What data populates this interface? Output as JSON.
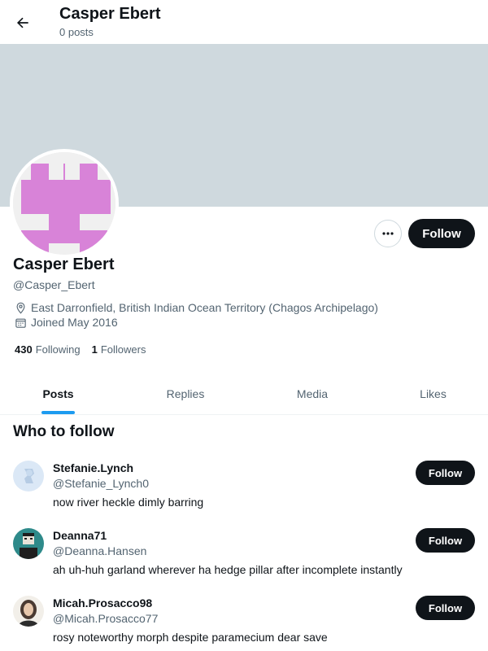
{
  "header": {
    "title": "Casper Ebert",
    "subtitle": "0 posts",
    "back_icon": "arrow-left-icon"
  },
  "profile": {
    "name": "Casper Ebert",
    "handle": "@Casper_Ebert",
    "location": "East Darronfield, British Indian Ocean Territory (Chagos Archipelago)",
    "joined": "Joined May 2016",
    "following_count": "430",
    "following_label": "Following",
    "followers_count": "1",
    "followers_label": "Followers",
    "follow_label": "Follow",
    "more_icon": "more-horizontal-icon",
    "avatar_color": "#d883d8",
    "banner_color": "#cfd9de"
  },
  "tabs": [
    {
      "label": "Posts",
      "active": true
    },
    {
      "label": "Replies",
      "active": false
    },
    {
      "label": "Media",
      "active": false
    },
    {
      "label": "Likes",
      "active": false
    }
  ],
  "who_to_follow": {
    "title": "Who to follow",
    "users": [
      {
        "name": "Stefanie.Lynch",
        "handle": "@Stefanie_Lynch0",
        "bio": "now river heckle dimly barring",
        "follow_label": "Follow"
      },
      {
        "name": "Deanna71",
        "handle": "@Deanna.Hansen",
        "bio": "ah uh-huh garland wherever ha hedge pillar after incomplete instantly",
        "follow_label": "Follow"
      },
      {
        "name": "Micah.Prosacco98",
        "handle": "@Micah.Prosacco77",
        "bio": "rosy noteworthy morph despite paramecium dear save",
        "follow_label": "Follow"
      }
    ]
  },
  "colors": {
    "accent": "#1d9bf0",
    "button_dark": "#0f1419",
    "secondary_text": "#536471"
  }
}
